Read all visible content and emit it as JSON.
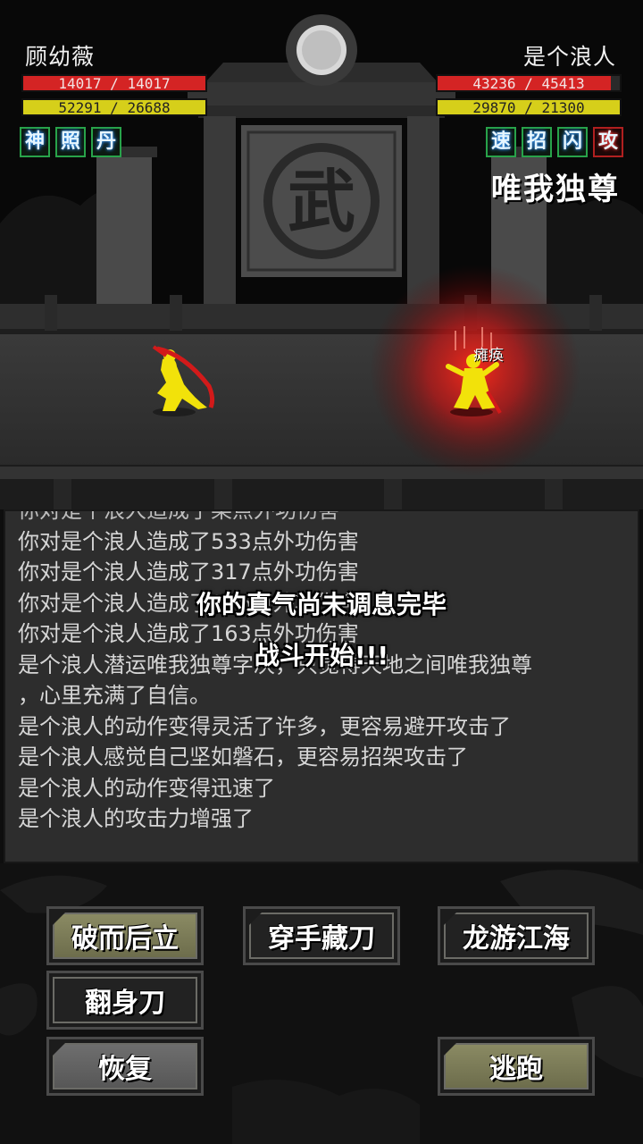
{
  "player": {
    "name": "顾幼薇",
    "hp_text": "14017 / 14017",
    "hp_fraction": 1.0,
    "mp_text": "52291 / 26688",
    "mp_fraction": 1.0,
    "buffs": [
      "神",
      "照",
      "丹"
    ]
  },
  "enemy": {
    "name": "是个浪人",
    "hp_text": "43236 / 45413",
    "hp_fraction": 0.952,
    "mp_text": "29870 / 21300",
    "mp_fraction": 1.0,
    "buffs": [
      "速",
      "招",
      "闪",
      "攻"
    ],
    "stance": "唯我独尊",
    "status_float": "瘫痪"
  },
  "scene": {
    "plaque_char": "武",
    "colors": {
      "enemy_aura": "#d01a1a",
      "fighter": "#f2e20a",
      "blade": "#d21a1a"
    }
  },
  "log": {
    "cut_line": "你对是个浪人造成了某点外功伤害",
    "lines": [
      "你对是个浪人造成了533点外功伤害",
      "你对是个浪人造成了317点外功伤害",
      "你对是个浪人造成了246点外功伤害",
      "你对是个浪人造成了163点外功伤害",
      "是个浪人潜运唯我独尊字决，只觉得天地之间唯我独尊",
      "，心里充满了自信。",
      "是个浪人的动作变得灵活了许多，更容易避开攻击了",
      "是个浪人感觉自己坚如磐石，更容易招架攻击了",
      "是个浪人的动作变得迅速了",
      "是个浪人的攻击力增强了"
    ]
  },
  "overlay": {
    "message1": "你的真气尚未调息完毕",
    "message2": "战斗开始!!!"
  },
  "skills": {
    "skill1": "破而后立",
    "skill2": "穿手藏刀",
    "skill3": "龙游江海",
    "skill4": "翻身刀",
    "recover": "恢复",
    "flee": "逃跑"
  }
}
